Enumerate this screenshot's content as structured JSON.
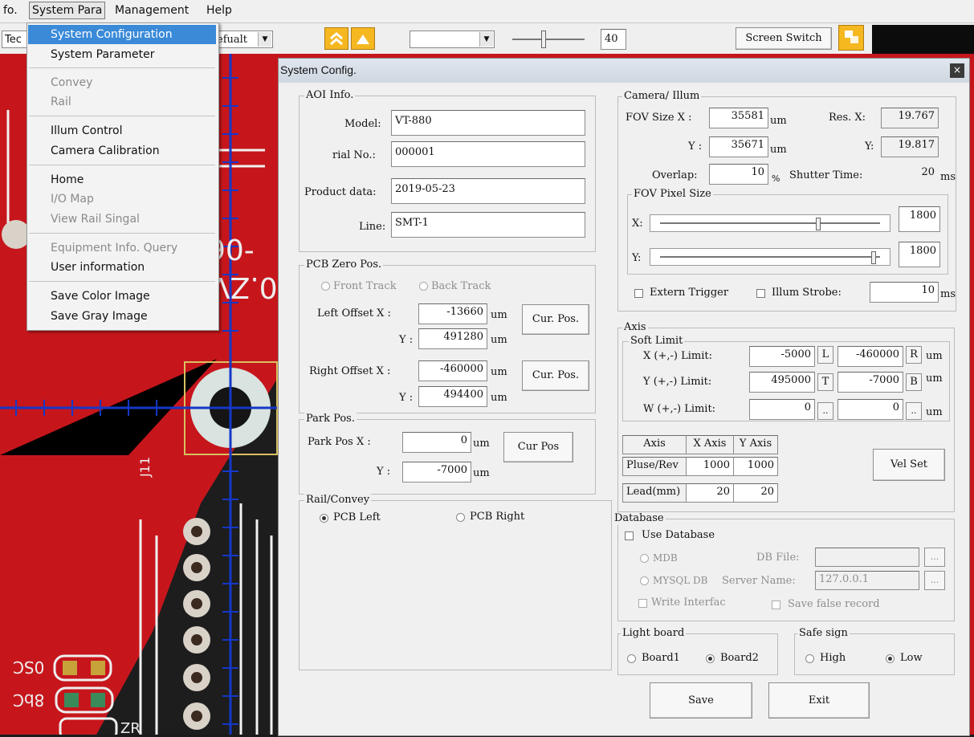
{
  "menubar": {
    "items": [
      "fo.",
      "System Para",
      "Management",
      "Help"
    ]
  },
  "toolbar": {
    "left_label": "Tec",
    "combo1": "efualt",
    "combo2": "",
    "slider_value": "40",
    "screen_switch": "Screen Switch"
  },
  "pcb_text": {
    "a": "90-",
    "b": "0.ZV",
    "c": "J11",
    "d": "0SC",
    "e": "8bC",
    "f": "ZR"
  },
  "system_menu": {
    "items": [
      {
        "label": "System Configuration",
        "state": "highlighted"
      },
      {
        "label": "System Parameter",
        "state": "enabled"
      },
      {
        "label": "Convey",
        "state": "disabled"
      },
      {
        "label": "Rail",
        "state": "disabled"
      },
      {
        "label": "Illum Control",
        "state": "enabled"
      },
      {
        "label": "Camera Calibration",
        "state": "enabled"
      },
      {
        "label": "Home",
        "state": "enabled"
      },
      {
        "label": "I/O Map",
        "state": "disabled"
      },
      {
        "label": "View Rail Singal",
        "state": "disabled"
      },
      {
        "label": "Equipment Info. Query",
        "state": "disabled"
      },
      {
        "label": "User information",
        "state": "enabled"
      },
      {
        "label": "Save Color Image",
        "state": "enabled"
      },
      {
        "label": "Save Gray Image",
        "state": "enabled"
      }
    ]
  },
  "dialog": {
    "title": "System Config.",
    "close": "×",
    "aoi": {
      "group": "AOI Info.",
      "model_label": "Model:",
      "model": "VT-880",
      "serial_label": "rial No.:",
      "serial": "000001",
      "product_label": "Product data:",
      "product": "2019-05-23",
      "line_label": "Line:",
      "line": "SMT-1"
    },
    "pcb_zero": {
      "group": "PCB Zero Pos.",
      "front_track": "Front Track",
      "back_track": "Back Track",
      "left_x_label": "Left Offset X :",
      "left_x": "-13660",
      "left_y_label": "Y :",
      "left_y": "491280",
      "right_x_label": "Right Offset X :",
      "right_x": "-460000",
      "right_y_label": "Y :",
      "right_y": "494400",
      "cur_pos": "Cur. Pos.",
      "unit": "um"
    },
    "park": {
      "group": "Park Pos.",
      "x_label": "Park Pos  X :",
      "x": "0",
      "y_label": "Y :",
      "y": "-7000",
      "unit": "um",
      "cur_pos": "Cur Pos"
    },
    "rail": {
      "group": "Rail/Convey",
      "left": "PCB Left",
      "right": "PCB Right"
    },
    "camera": {
      "group": "Camera/ Illum",
      "fov_x_label": "FOV Size X :",
      "fov_x": "35581",
      "fov_y_label": "Y :",
      "fov_y": "35671",
      "unit": "um",
      "res_x_label": "Res. X:",
      "res_x": "19.767",
      "res_y_label": "Y:",
      "res_y": "19.817",
      "overlap_label": "Overlap:",
      "overlap": "10",
      "overlap_unit": "%",
      "shutter_label": "Shutter Time:",
      "shutter": "20",
      "ms": "ms",
      "pixel_group": "FOV Pixel Size",
      "px_x_label": "X:",
      "px_x": "1800",
      "px_y_label": "Y:",
      "px_y": "1800",
      "slider_x_pct": 0.72,
      "slider_y_pct": 0.97,
      "extern_trigger": "Extern Trigger",
      "illum_strobe": "Illum Strobe:",
      "strobe": "10"
    },
    "axis": {
      "group": "Axis",
      "soft_limit": "Soft Limit",
      "x_label": "X (+,-) Limit:",
      "x_pos": "-5000",
      "x_btn": "L",
      "x_neg": "-460000",
      "x_btn2": "R",
      "y_label": "Y (+,-) Limit:",
      "y_pos": "495000",
      "y_btn": "T",
      "y_neg": "-7000",
      "y_btn2": "B",
      "w_label": "W (+,-) Limit:",
      "w_pos": "0",
      "w_btn": "..",
      "w_neg": "0",
      "w_btn2": "..",
      "unit": "um",
      "table_head": [
        "Axis",
        "X Axis",
        "Y Axis"
      ],
      "pluse_label": "Pluse/Rev",
      "pluse_x": "1000",
      "pluse_y": "1000",
      "lead_label": "Lead(mm)",
      "lead_x": "20",
      "lead_y": "20",
      "vel_set": "Vel Set"
    },
    "database": {
      "group": "Database",
      "use": "Use Database",
      "mdb": "MDB",
      "db_file": "DB File:",
      "mysql": "MYSQL DB",
      "server_name": "Server Name:",
      "server": "127.0.0.1",
      "browse": "...",
      "write": "Write Interfac",
      "save_false": "Save false record"
    },
    "light": {
      "group": "Light board",
      "b1": "Board1",
      "b2": "Board2"
    },
    "safe": {
      "group": "Safe sign",
      "high": "High",
      "low": "Low"
    },
    "save": "Save",
    "exit": "Exit"
  }
}
